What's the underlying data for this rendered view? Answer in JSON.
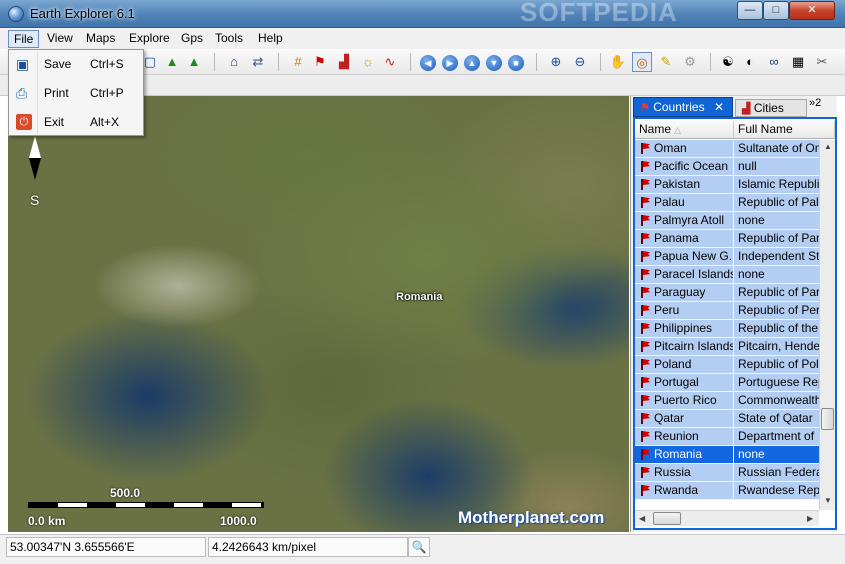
{
  "window": {
    "title": "Earth Explorer 6.1",
    "watermark": "SOFTPEDIA",
    "btn_min": "—",
    "btn_max": "□",
    "btn_close": "✕"
  },
  "menu": {
    "file": "File",
    "view": "View",
    "maps": "Maps",
    "explore": "Explore",
    "gps": "Gps",
    "tools": "Tools",
    "help": "Help"
  },
  "file_menu": {
    "save": {
      "label": "Save",
      "shortcut": "Ctrl+S"
    },
    "print": {
      "label": "Print",
      "shortcut": "Ctrl+P"
    },
    "exit": {
      "label": "Exit",
      "shortcut": "Alt+X"
    }
  },
  "map": {
    "compass_label": "S",
    "place_label": "Romania",
    "scale_mid": "500.0",
    "scale_start": "0.0 km",
    "scale_end": "1000.0",
    "brand": "Motherplanet.com"
  },
  "panel": {
    "tab_countries": "Countries",
    "tab_cities": "Cities",
    "tab_more": "»2",
    "col_name": "Name",
    "col_full": "Full Name",
    "rows": [
      {
        "name": "Oman",
        "full": "Sultanate of Oman"
      },
      {
        "name": "Pacific Ocean",
        "full": "null"
      },
      {
        "name": "Pakistan",
        "full": "Islamic Republic"
      },
      {
        "name": "Palau",
        "full": "Republic of Palau"
      },
      {
        "name": "Palmyra Atoll",
        "full": "none"
      },
      {
        "name": "Panama",
        "full": "Republic of Panama"
      },
      {
        "name": "Papua New G...",
        "full": "Independent State"
      },
      {
        "name": "Paracel Islands",
        "full": "none"
      },
      {
        "name": "Paraguay",
        "full": "Republic of Paraguay"
      },
      {
        "name": "Peru",
        "full": "Republic of Peru"
      },
      {
        "name": "Philippines",
        "full": "Republic of the"
      },
      {
        "name": "Pitcairn Islands",
        "full": "Pitcairn, Henderson"
      },
      {
        "name": "Poland",
        "full": "Republic of Poland"
      },
      {
        "name": "Portugal",
        "full": "Portuguese Republic"
      },
      {
        "name": "Puerto Rico",
        "full": "Commonwealth"
      },
      {
        "name": "Qatar",
        "full": "State of Qatar"
      },
      {
        "name": "Reunion",
        "full": "Department of"
      },
      {
        "name": "Romania",
        "full": "none"
      },
      {
        "name": "Russia",
        "full": "Russian Federation"
      },
      {
        "name": "Rwanda",
        "full": "Rwandese Republic"
      }
    ],
    "selected_index": 17
  },
  "status": {
    "coords": "53.00347'N  3.655566'E",
    "scale": "4.2426643 km/pixel"
  },
  "colors": {
    "selection": "#1268e0",
    "row": "#b4cdf2",
    "tab_active": "#1064d6"
  }
}
